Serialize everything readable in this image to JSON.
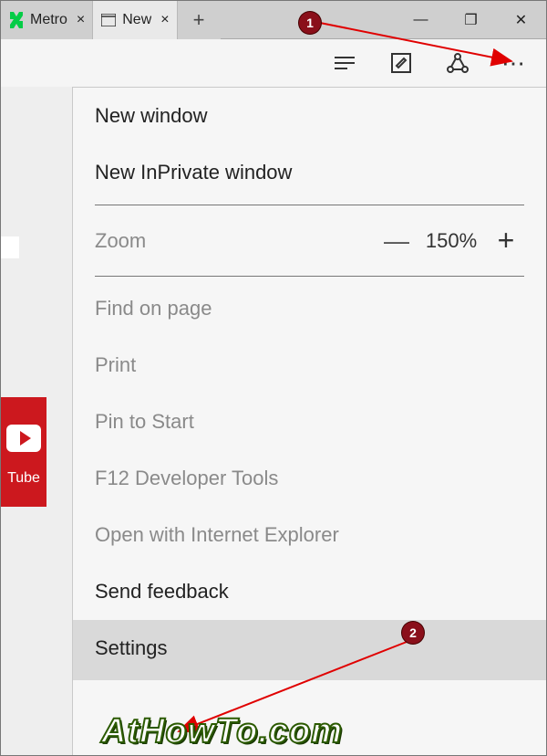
{
  "tabs": [
    {
      "label": "Metro",
      "close": "×"
    },
    {
      "label": "New",
      "close": "×"
    }
  ],
  "newtab_glyph": "+",
  "window_controls": {
    "minimize": "—",
    "maximize": "❐",
    "close": "✕"
  },
  "toolbar_icons": {
    "reading": "reading-view-icon",
    "note": "web-note-icon",
    "share": "share-icon",
    "more": "⋯"
  },
  "menu": {
    "new_window": "New window",
    "new_inprivate": "New InPrivate window",
    "zoom_label": "Zoom",
    "zoom_value": "150%",
    "zoom_minus": "—",
    "zoom_plus": "+",
    "find": "Find on page",
    "print": "Print",
    "pin": "Pin to Start",
    "devtools": "F12 Developer Tools",
    "open_ie": "Open with Internet Explorer",
    "feedback": "Send feedback",
    "settings": "Settings"
  },
  "callouts": {
    "one": "1",
    "two": "2"
  },
  "side_tile_label": "Tube",
  "watermark": "AtHowTo.com"
}
